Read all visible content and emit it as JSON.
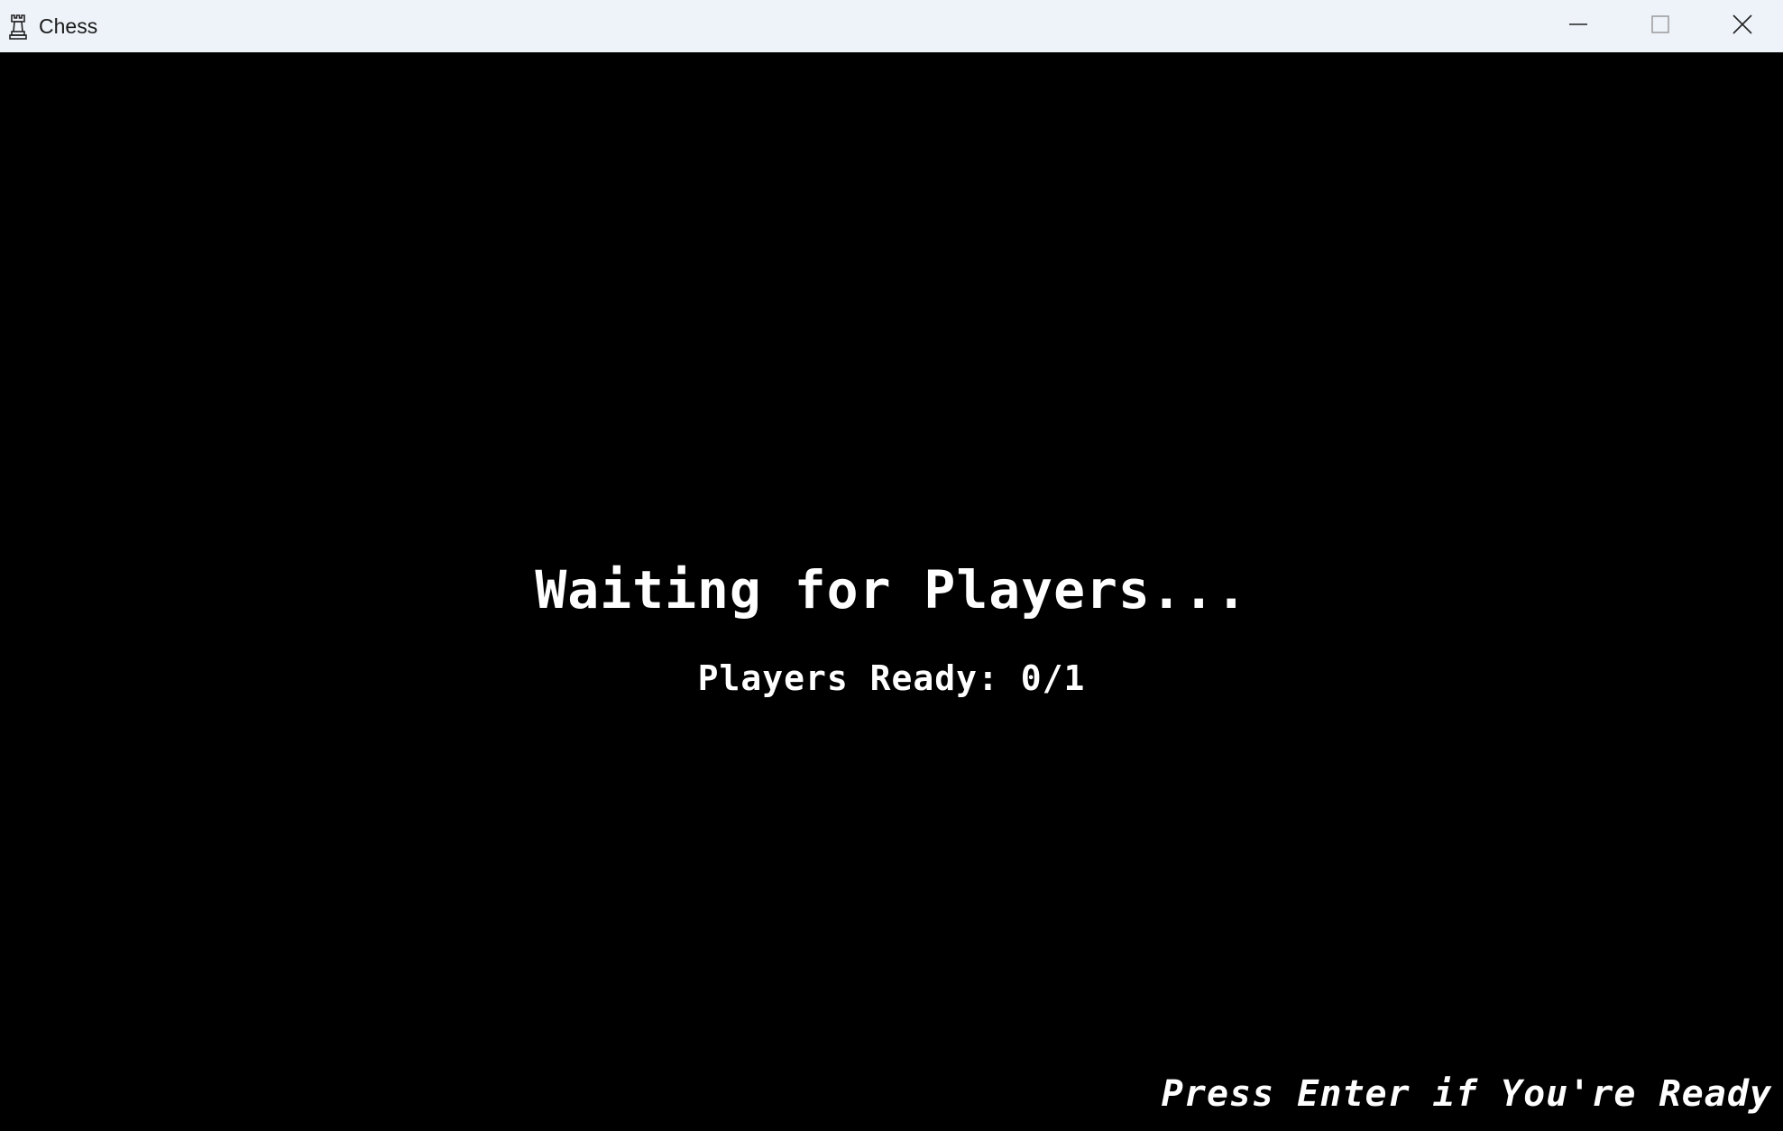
{
  "window": {
    "title": "Chess",
    "icon": "rook-icon",
    "controls": {
      "minimize_icon": "minimize-icon",
      "maximize_icon": "maximize-icon",
      "close_icon": "close-icon"
    }
  },
  "game": {
    "heading": "Waiting for Players...",
    "ready_status": "Players Ready: 0/1",
    "prompt": "Press Enter if You're Ready"
  },
  "colors": {
    "titlebar_bg": "#eef2f9",
    "content_bg": "#000000",
    "text": "#ffffff"
  }
}
